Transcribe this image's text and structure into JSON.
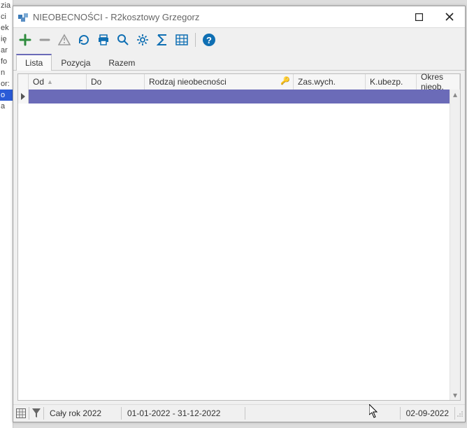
{
  "title": "NIEOBECNOŚCI - R2kosztowy Grzegorz",
  "tabs": {
    "lista": "Lista",
    "pozycja": "Pozycja",
    "razem": "Razem"
  },
  "columns": {
    "od": "Od",
    "do": "Do",
    "rodzaj": "Rodzaj nieobecności",
    "zas": "Zas.wych.",
    "kubezp": "K.ubezp.",
    "okres": "Okres nieob."
  },
  "status": {
    "range_label": "Cały rok 2022",
    "range": "01-01-2022 - 31-12-2022",
    "date": "02-09-2022"
  },
  "side": [
    "zia",
    "ci",
    "ek",
    "ię",
    "ar",
    "fo",
    "n",
    "or:",
    "o",
    "a"
  ]
}
